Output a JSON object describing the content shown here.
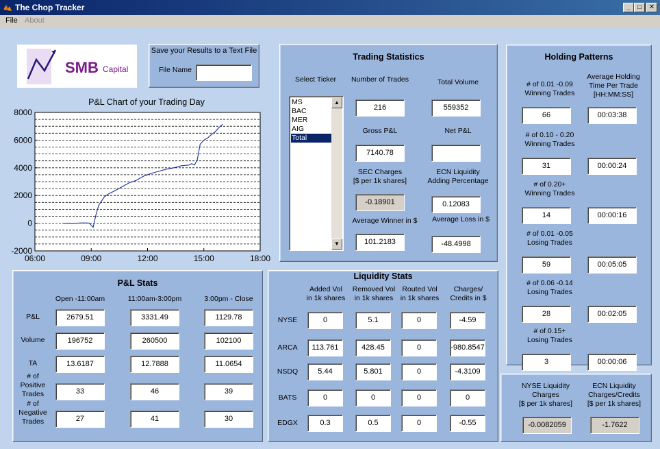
{
  "window": {
    "title": "The Chop Tracker",
    "min_glyph": "_",
    "max_glyph": "□",
    "close_glyph": "✕"
  },
  "menu": {
    "file": "File",
    "about": "About"
  },
  "logo": {
    "text_smb": "SMB",
    "text_capital": "Capital"
  },
  "save": {
    "title": "Save your Results to a Text File",
    "file_name_label": "File Name",
    "file_name_value": ""
  },
  "chart_data": {
    "type": "line",
    "title": "P&L Chart of your Trading Day",
    "x_ticks": [
      "06:00",
      "09:00",
      "12:00",
      "15:00",
      "18:00"
    ],
    "y_ticks": [
      "8000",
      "6000",
      "4000",
      "2000",
      "0",
      "-2000"
    ],
    "xlim": [
      6,
      18
    ],
    "ylim": [
      -2000,
      8000
    ],
    "grid": "horizontal dashed",
    "series": [
      {
        "x": [
          7.5,
          8.0,
          8.5,
          8.9,
          9.1,
          9.25,
          9.4,
          9.55,
          9.7,
          9.9,
          10.2,
          10.6,
          11.0,
          11.4,
          11.8,
          12.2,
          12.6,
          13.0,
          13.4,
          13.8,
          14.2,
          14.35,
          14.5,
          14.65,
          14.8,
          15.0,
          15.2,
          15.4,
          15.6,
          15.8,
          16.0
        ],
        "y": [
          0,
          -10,
          20,
          10,
          -300,
          600,
          1300,
          1600,
          1900,
          2100,
          2300,
          2600,
          2900,
          3100,
          3400,
          3600,
          3750,
          3900,
          4000,
          4150,
          4200,
          4300,
          4200,
          4600,
          5700,
          6000,
          6150,
          6400,
          6600,
          6900,
          7150
        ]
      }
    ]
  },
  "trading": {
    "title": "Trading Statistics",
    "select_ticker": "Select Ticker",
    "tickers": [
      "MS",
      "BAC",
      "MER",
      "AIG",
      "Total"
    ],
    "selected": "Total",
    "num_trades_label": "Number of Trades",
    "num_trades": "216",
    "total_volume_label": "Total Volume",
    "total_volume": "559352",
    "gross_pnl_label": "Gross P&L",
    "gross_pnl": "7140.78",
    "net_pnl_label": "Net P&L",
    "net_pnl": "",
    "sec_label_1": "SEC Charges",
    "sec_label_2": "[$ per 1k shares]",
    "sec": "-0.18901",
    "ecn_label_1": "ECN Liquidity",
    "ecn_label_2": "Adding Percentage",
    "ecn_pct": "0.12083",
    "avg_winner_label": "Average Winner in $",
    "avg_winner": "101.2183",
    "avg_loss_label": "Average Loss in $",
    "avg_loss": "-48.4998",
    "up_arrow": "▲",
    "down_arrow": "▼"
  },
  "holding": {
    "title": "Holding Patterns",
    "avg_label_1": "Average Holding",
    "avg_label_2": "Time Per Trade",
    "avg_label_3": "[HH:MM:SS]",
    "rows": [
      {
        "l1": "# of 0.01 -0.09",
        "l2": "Winning Trades",
        "count": "66",
        "time": "00:03:38"
      },
      {
        "l1": "# of  0.10 - 0.20",
        "l2": "Winning Trades",
        "count": "31",
        "time": "00:00:24"
      },
      {
        "l1": "# of 0.20+",
        "l2": "Winning Trades",
        "count": "14",
        "time": "00:00:16"
      },
      {
        "l1": "# of 0.01 -0.05",
        "l2": "Losing Trades",
        "count": "59",
        "time": "00:05:05"
      },
      {
        "l1": "# of 0.06 -0.14",
        "l2": "Losing Trades",
        "count": "28",
        "time": "00:02:05"
      },
      {
        "l1": "# of  0.15+",
        "l2": "Losing Trades",
        "count": "3",
        "time": "00:00:06"
      }
    ]
  },
  "pnl_stats": {
    "title": "P&L Stats",
    "cols": [
      "Open -11:00am",
      "11:00am-3:00pm",
      "3:00pm - Close"
    ],
    "rows": [
      {
        "label": "P&L",
        "values": [
          "2679.51",
          "3331.49",
          "1129.78"
        ]
      },
      {
        "label": "Volume",
        "values": [
          "196752",
          "260500",
          "102100"
        ]
      },
      {
        "label": "TA",
        "values": [
          "13.6187",
          "12.7888",
          "11.0654"
        ]
      },
      {
        "label_lines": [
          "# of",
          "Positive",
          "Trades"
        ],
        "values": [
          "33",
          "46",
          "39"
        ]
      },
      {
        "label_lines": [
          "# of",
          "Negative",
          "Trades"
        ],
        "values": [
          "27",
          "41",
          "30"
        ]
      }
    ]
  },
  "liquidity": {
    "title": "Liquidity Stats",
    "cols": [
      [
        "Added Vol",
        "in 1k shares"
      ],
      [
        "Removed Vol",
        "in 1k shares"
      ],
      [
        "Routed Vol",
        "in 1k shares"
      ],
      [
        "Charges/",
        "Credits in $"
      ]
    ],
    "rows": [
      {
        "label": "NYSE",
        "values": [
          "0",
          "5.1",
          "0",
          "-4.59"
        ]
      },
      {
        "label": "ARCA",
        "values": [
          "113.761",
          "428.45",
          "0",
          "-980.8547"
        ]
      },
      {
        "label": "NSDQ",
        "values": [
          "5.44",
          "5.801",
          "0",
          "-4.3109"
        ]
      },
      {
        "label": "BATS",
        "values": [
          "0",
          "0",
          "0",
          "0"
        ]
      },
      {
        "label": "EDGX",
        "values": [
          "0.3",
          "0.5",
          "0",
          "-0.55"
        ]
      }
    ]
  },
  "liq_charges": {
    "nyse_l1": "NYSE Liquidity",
    "nyse_l2": "Charges",
    "nyse_l3": "[$ per 1k shares]",
    "nyse": "-0.0082059",
    "ecn_l1": "ECN Liquidity",
    "ecn_l2": "Charges/Credits",
    "ecn_l3": "[$ per 1k shares]",
    "ecn": "-1.7622"
  },
  "colors": {
    "titlebar": "#0a246a",
    "panel": "#9bb6dd",
    "background": "#c0d4ee",
    "line": "#1a2aa0",
    "selection": "#0a246a",
    "logo_text": "#7b1a8a"
  }
}
